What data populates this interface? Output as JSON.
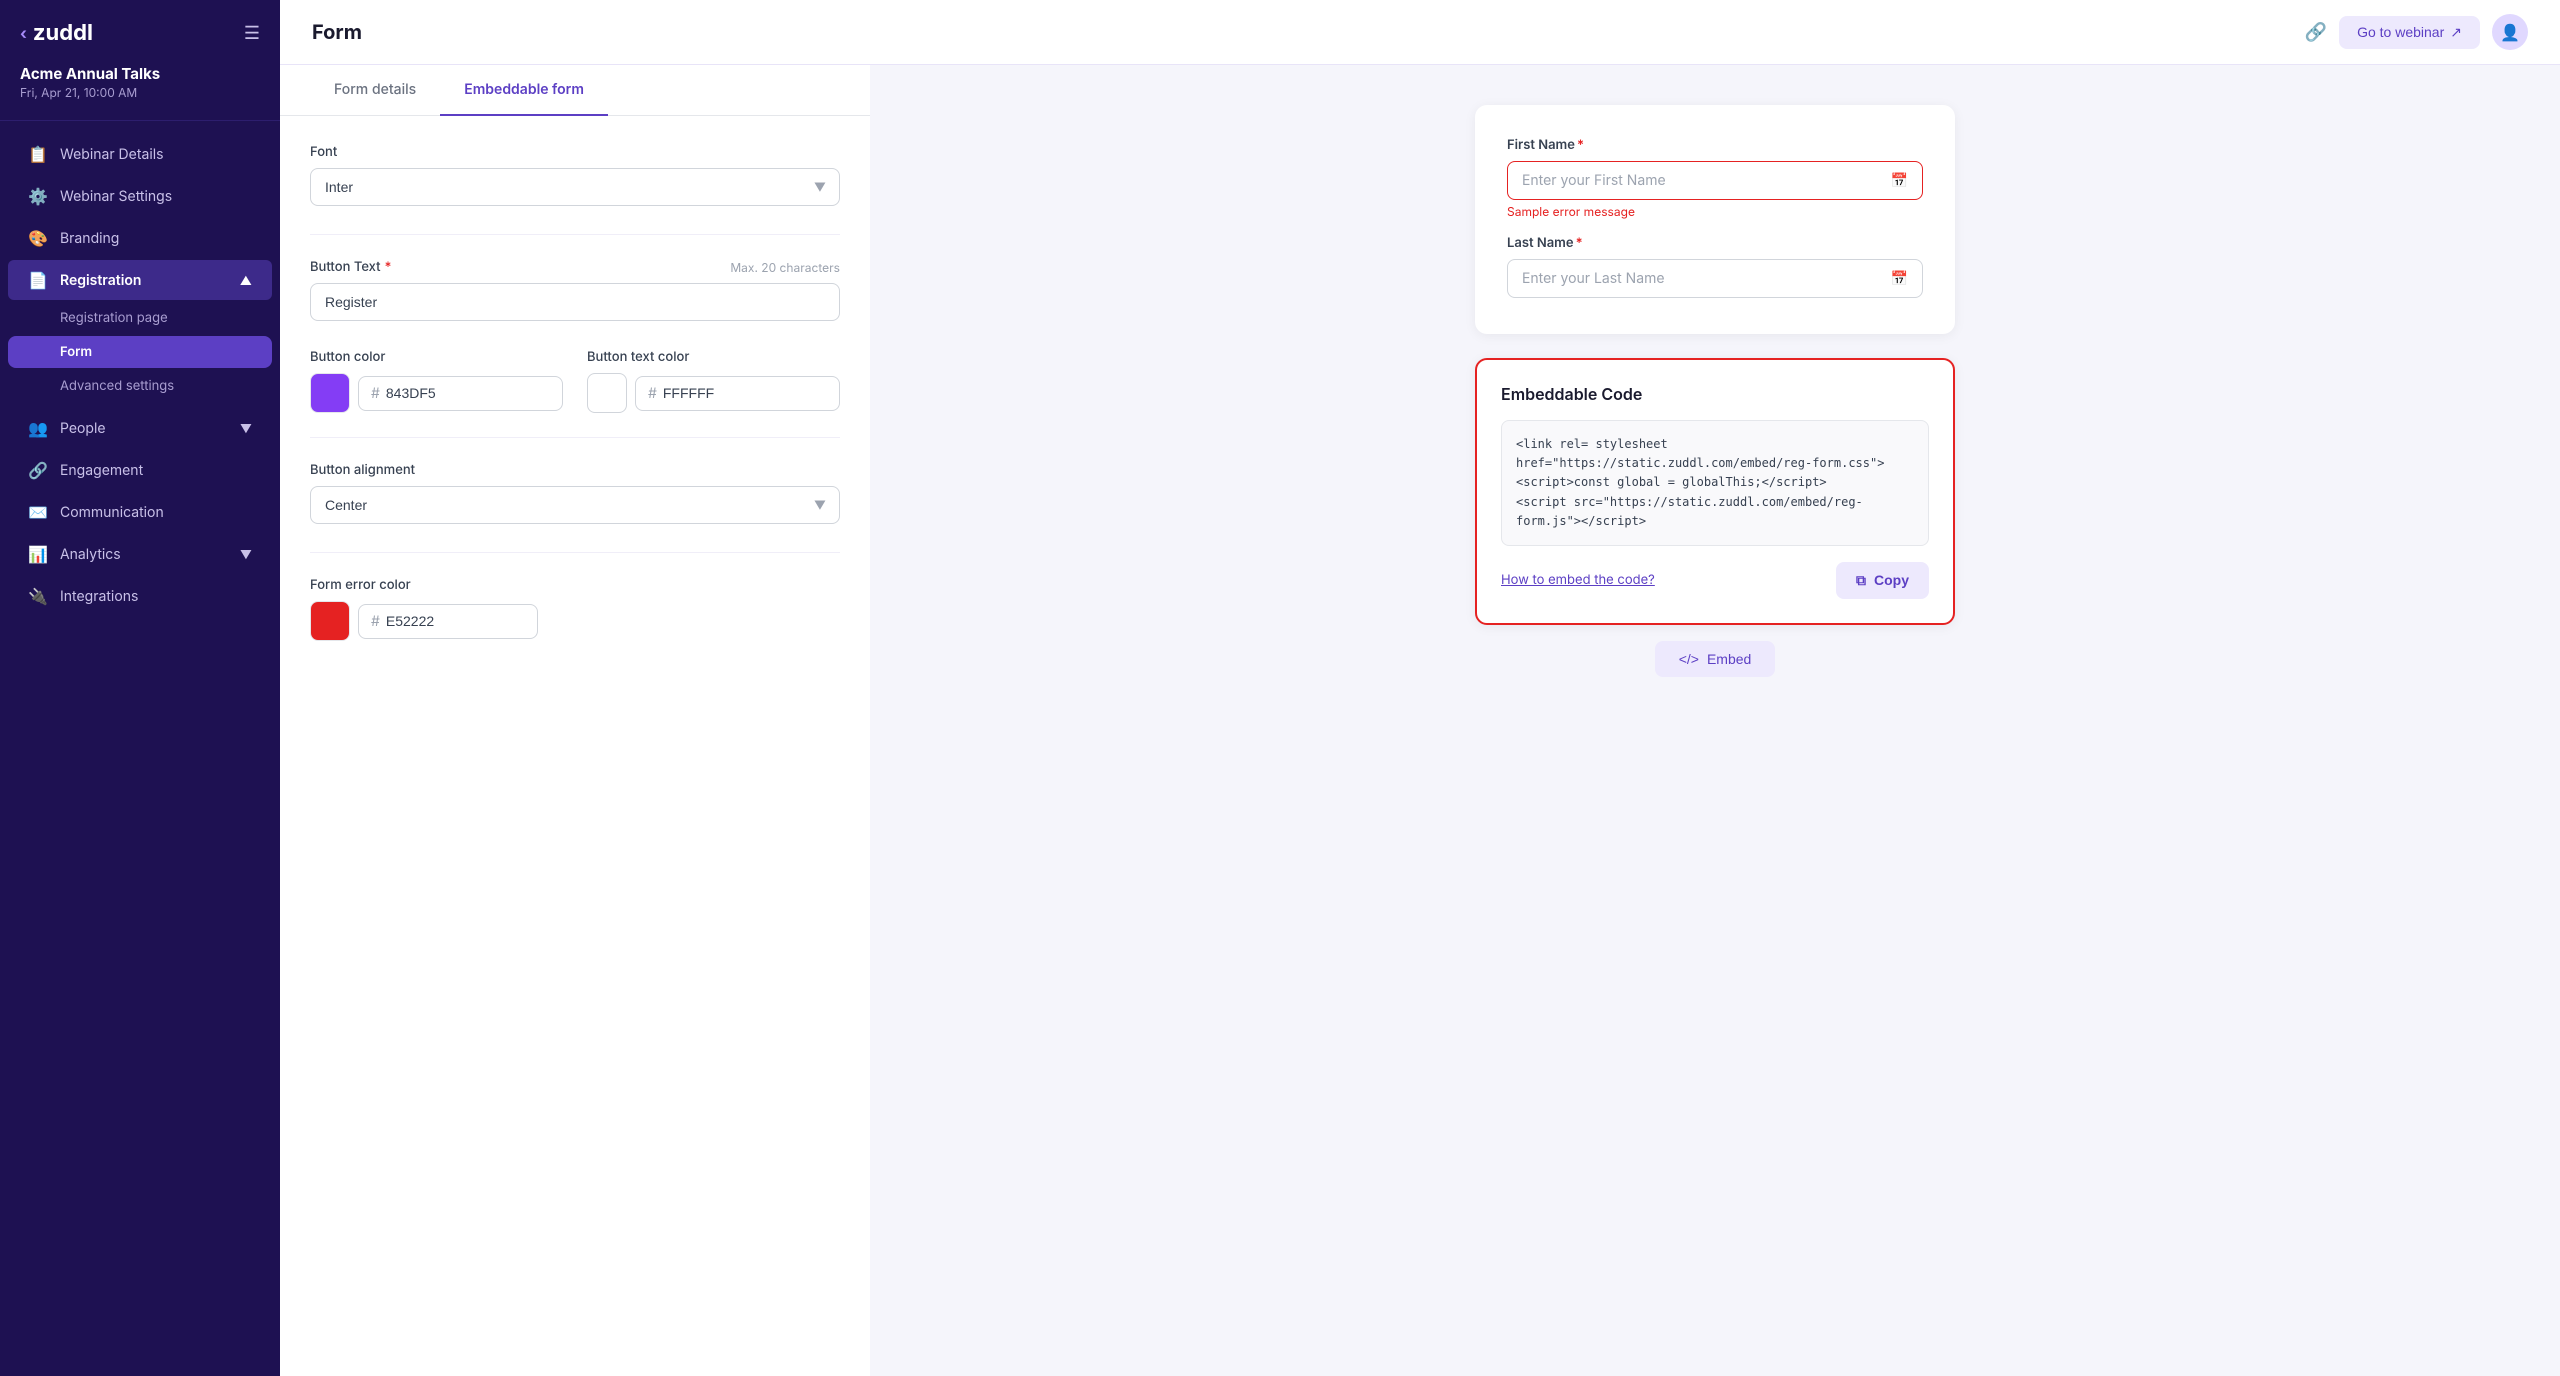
{
  "sidebar": {
    "logo": "zuddl",
    "event_name": "Acme Annual Talks",
    "event_date": "Fri, Apr 21, 10:00 AM",
    "nav_items": [
      {
        "id": "webinar-details",
        "label": "Webinar Details",
        "icon": "📋",
        "active": false
      },
      {
        "id": "webinar-settings",
        "label": "Webinar Settings",
        "icon": "⚙️",
        "active": false
      },
      {
        "id": "branding",
        "label": "Branding",
        "icon": "🎨",
        "active": false
      },
      {
        "id": "registration",
        "label": "Registration",
        "icon": "📄",
        "active": true,
        "has_chevron": true
      },
      {
        "id": "people",
        "label": "People",
        "icon": "👥",
        "active": false,
        "has_chevron": true
      },
      {
        "id": "engagement",
        "label": "Engagement",
        "icon": "🔗",
        "active": false
      },
      {
        "id": "communication",
        "label": "Communication",
        "icon": "✉️",
        "active": false
      },
      {
        "id": "analytics",
        "label": "Analytics",
        "icon": "📊",
        "active": false,
        "has_chevron": true
      },
      {
        "id": "integrations",
        "label": "Integrations",
        "icon": "🔌",
        "active": false
      }
    ],
    "registration_sub": [
      {
        "id": "registration-page",
        "label": "Registration page",
        "active": false
      },
      {
        "id": "form",
        "label": "Form",
        "active": true
      },
      {
        "id": "advanced-settings",
        "label": "Advanced settings",
        "active": false
      }
    ]
  },
  "topbar": {
    "title": "Form",
    "go_to_webinar_label": "Go to webinar",
    "link_icon": "🔗"
  },
  "tabs": [
    {
      "id": "form-details",
      "label": "Form details",
      "active": false
    },
    {
      "id": "embeddable-form",
      "label": "Embeddable form",
      "active": true
    }
  ],
  "form": {
    "font_label": "Font",
    "font_value": "Inter",
    "button_text_label": "Button Text",
    "button_text_required": true,
    "button_text_hint": "Max. 20 characters",
    "button_text_value": "Register",
    "button_color_label": "Button color",
    "button_color_hex": "843DF5",
    "button_color_swatch": "#843DF5",
    "button_text_color_label": "Button text color",
    "button_text_color_hex": "FFFFFF",
    "button_text_color_swatch": "#FFFFFF",
    "button_alignment_label": "Button alignment",
    "button_alignment_value": "Center",
    "form_error_color_label": "Form error color",
    "form_error_color_hex": "E52222",
    "form_error_color_swatch": "#E52222"
  },
  "preview": {
    "first_name_label": "First Name",
    "first_name_required": true,
    "first_name_placeholder": "Enter your First Name",
    "first_name_error": "Sample error message",
    "last_name_label": "Last Name",
    "last_name_required": true,
    "last_name_placeholder": "Enter your Last Name"
  },
  "embed_code": {
    "title": "Embeddable Code",
    "code": "<link rel= stylesheet href=\"https://static.zuddl.com/embed/reg-form.css\">\n<script>const global = globalThis;</script>\n<script src=\"https://static.zuddl.com/embed/reg-form.js\"></script>",
    "how_to_link": "How to embed the code?",
    "copy_label": "Copy",
    "embed_button_label": "Embed"
  }
}
